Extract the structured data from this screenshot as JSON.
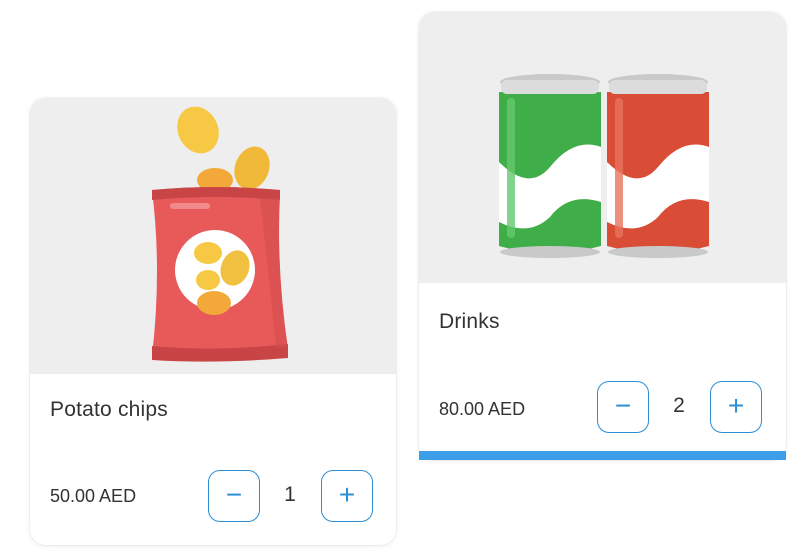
{
  "products": [
    {
      "title": "Potato chips",
      "price": "50.00 AED",
      "quantity": "1",
      "minus_label": "−",
      "plus_label": "+"
    },
    {
      "title": "Drinks",
      "price": "80.00 AED",
      "quantity": "2",
      "minus_label": "−",
      "plus_label": "+"
    }
  ],
  "colors": {
    "accent": "#2b8fd6",
    "selected_bar": "#3d9ee8",
    "media_background": "#eeeeee"
  }
}
